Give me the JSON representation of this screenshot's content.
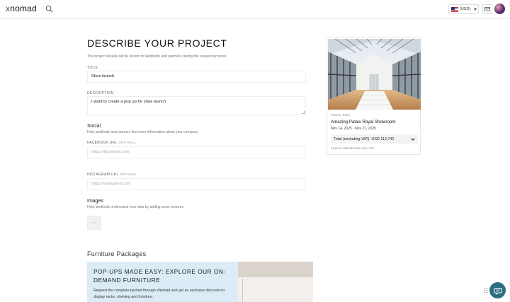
{
  "header": {
    "logo_prefix": "x",
    "logo_text": "nomad",
    "currency": "(USD)"
  },
  "form": {
    "title": "DESCRIBE YOUR PROJECT",
    "subtitle": "The project details will be shown to landlords and partners during the request process.",
    "title_label": "TITLE",
    "title_value": "Shoe launch",
    "description_label": "DESCRIPTION",
    "description_value": "I want to create a pop up for shoe launch",
    "social": {
      "heading": "Social",
      "subheading": "Help landlords and partners find more information about your company.",
      "facebook_label": "FACEBOOK URL",
      "facebook_optional": "OPTIONAL",
      "facebook_placeholder": "https://facebook.com",
      "instagram_label": "INSTAGRAM URL",
      "instagram_optional": "OPTIONAL",
      "instagram_placeholder": "https://instagram.com"
    },
    "images": {
      "heading": "Images",
      "subheading": "Help landlords understand your idea by adding some pictures",
      "add_label": "+"
    },
    "furniture": {
      "heading": "Furniture Packages",
      "promo_title": "POP-UPS MADE EASY: EXPLORE OUR ON-DEMAND FURNITURE",
      "promo_text": "Request the complete packed through xNomad and get an exclusive discount on display racks, shelving and furniture."
    }
  },
  "listing": {
    "location": "France, Paris",
    "name": "Amazing Palais Royal Showroom",
    "dates": "Nov 14, 2025 - Nov 21, 2025",
    "total": "Total (excluding VAT): USD 112,742",
    "note": "All price estimates are excl. VAT"
  },
  "colors": {
    "accent": "#2c6e86",
    "promo_bg": "#dcecf7",
    "price_bg": "#f3f3f3"
  },
  "icons": {
    "search": "search-icon",
    "mail": "mail-icon",
    "chat": "chat-icon",
    "flag": "us-flag-icon",
    "drag": "drag-dots-icon"
  }
}
